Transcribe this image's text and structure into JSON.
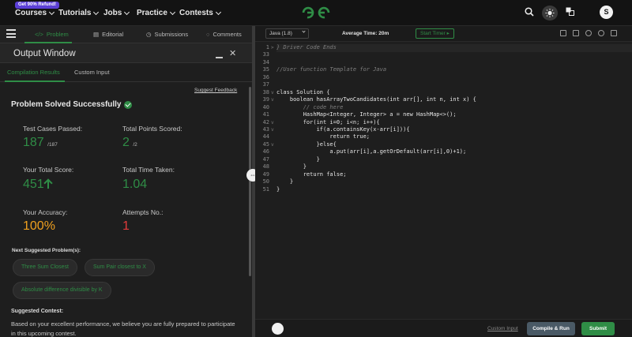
{
  "topnav": {
    "promo": "Get 90% Refund!",
    "items": [
      {
        "label": "Courses"
      },
      {
        "label": "Tutorials"
      },
      {
        "label": "Jobs"
      },
      {
        "label": "Practice"
      },
      {
        "label": "Contests"
      }
    ],
    "logo_text": "GfG",
    "avatar_initial": "S"
  },
  "left_tabs": [
    {
      "label": "Problem",
      "icon": "code-icon"
    },
    {
      "label": "Editorial",
      "icon": "document-icon"
    },
    {
      "label": "Submissions",
      "icon": "history-icon"
    },
    {
      "label": "Comments",
      "icon": "comment-icon"
    }
  ],
  "output": {
    "title": "Output Window",
    "tabs": [
      "Compilation Results",
      "Custom Input"
    ],
    "suggest_feedback": "Suggest Feedback",
    "status": "Problem Solved Successfully",
    "stats": {
      "test_cases_label": "Test Cases Passed:",
      "test_cases_value": "187",
      "test_cases_total": "/187",
      "points_label": "Total Points Scored:",
      "points_value": "2",
      "points_total": "/2",
      "score_label": "Your Total Score:",
      "score_value": "451",
      "time_label": "Total Time Taken:",
      "time_value": "1.04",
      "accuracy_label": "Your Accuracy:",
      "accuracy_value": "100%",
      "attempts_label": "Attempts No.:",
      "attempts_value": "1"
    },
    "next_suggested_label": "Next Suggested Problem(s):",
    "suggestions": [
      "Three Sum Closest",
      "Sum Pair closest to X",
      "Absolute difference divisible by K"
    ],
    "contest_label": "Suggested Contest:",
    "contest_text": "Based on your excellent performance, we believe you are fully prepared to participate in this upcoming contest."
  },
  "editor": {
    "language": "Java (1.8)",
    "avg_time": "Average Time: 20m",
    "start_timer": "Start Timer",
    "lines": [
      {
        "n": "1",
        "text": "} Driver Code Ends",
        "type": "comment",
        "fold": ">"
      },
      {
        "n": "33",
        "text": "",
        "type": "code",
        "fold": ""
      },
      {
        "n": "34",
        "text": "",
        "type": "code",
        "fold": ""
      },
      {
        "n": "35",
        "text": "//User function Template for Java",
        "type": "comment",
        "fold": ""
      },
      {
        "n": "36",
        "text": "",
        "type": "code",
        "fold": ""
      },
      {
        "n": "37",
        "text": "",
        "type": "code",
        "fold": ""
      },
      {
        "n": "38",
        "text": "class Solution {",
        "type": "code",
        "fold": "v"
      },
      {
        "n": "39",
        "text": "    boolean hasArrayTwoCandidates(int arr[], int n, int x) {",
        "type": "code",
        "fold": "v"
      },
      {
        "n": "40",
        "text": "        // code here",
        "type": "comment",
        "fold": ""
      },
      {
        "n": "41",
        "text": "        HashMap<Integer, Integer> a = new HashMap<>();",
        "type": "code",
        "fold": ""
      },
      {
        "n": "42",
        "text": "        for(int i=0; i<n; i++){",
        "type": "code",
        "fold": "v"
      },
      {
        "n": "43",
        "text": "            if(a.containsKey(x-arr[i])){",
        "type": "code",
        "fold": "v"
      },
      {
        "n": "44",
        "text": "                return true;",
        "type": "code",
        "fold": ""
      },
      {
        "n": "45",
        "text": "            }else{",
        "type": "code",
        "fold": "v"
      },
      {
        "n": "46",
        "text": "                a.put(arr[i],a.getOrDefault(arr[i],0)+1);",
        "type": "code",
        "fold": ""
      },
      {
        "n": "47",
        "text": "            }",
        "type": "code",
        "fold": ""
      },
      {
        "n": "48",
        "text": "        }",
        "type": "code",
        "fold": ""
      },
      {
        "n": "49",
        "text": "        return false;",
        "type": "code",
        "fold": ""
      },
      {
        "n": "50",
        "text": "    }",
        "type": "code",
        "fold": ""
      },
      {
        "n": "51",
        "text": "}",
        "type": "code",
        "fold": ""
      }
    ],
    "custom_input": "Custom Input",
    "compile_run": "Compile & Run",
    "submit": "Submit"
  },
  "colors": {
    "accent_green": "#2f8d46",
    "accuracy_orange": "#f0a01e",
    "attempts_red": "#e23b3b"
  }
}
